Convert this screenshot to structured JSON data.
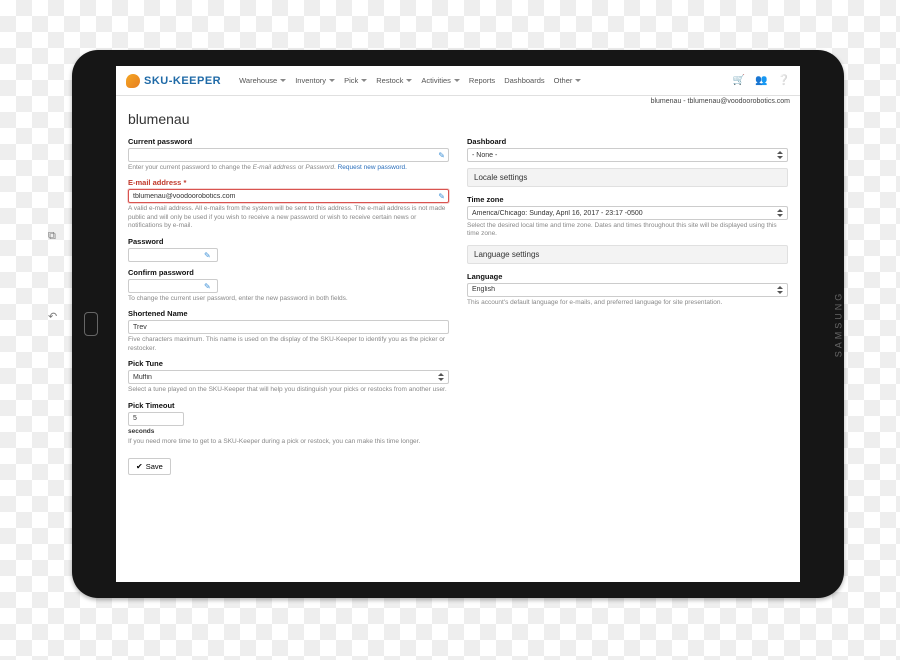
{
  "brand_side": "SAMSUNG",
  "logo_text": "SKU-KEEPER",
  "nav": [
    "Warehouse",
    "Inventory",
    "Pick",
    "Restock",
    "Activities",
    "Reports",
    "Dashboards",
    "Other"
  ],
  "nav_has_caret": [
    true,
    true,
    true,
    true,
    true,
    false,
    false,
    true
  ],
  "user_line": "blumenau - tblumenau@voodoorobotics.com",
  "page_title": "blumenau",
  "left": {
    "current_password": {
      "label": "Current password",
      "value": "",
      "help_pre": "Enter your current password to change the ",
      "help_em": "E-mail address",
      "help_mid": " or ",
      "help_em2": "Password",
      "help_suf": ". ",
      "link": "Request new password."
    },
    "email": {
      "label": "E-mail address",
      "value": "tblumenau@voodoorobotics.com",
      "help": "A valid e-mail address. All e-mails from the system will be sent to this address. The e-mail address is not made public and will only be used if you wish to receive a new password or wish to receive certain news or notifications by e-mail."
    },
    "password": {
      "label": "Password"
    },
    "confirm": {
      "label": "Confirm password",
      "help": "To change the current user password, enter the new password in both fields."
    },
    "shortname": {
      "label": "Shortened Name",
      "value": "Trev",
      "help": "Five characters maximum. This name is used on the display of the SKU-Keeper to identify you as the picker or restocker."
    },
    "picktune": {
      "label": "Pick Tune",
      "value": "Muffin",
      "help": "Select a tune played on the SKU-Keeper that will help you distinguish your picks or restocks from another user."
    },
    "timeout": {
      "label": "Pick Timeout",
      "value": "5",
      "unit": "seconds",
      "help": "If you need more time to get to a SKU-Keeper during a pick or restock, you can make this time longer."
    },
    "save": "Save"
  },
  "right": {
    "dash_label": "Dashboard",
    "dash_value": "- None -",
    "locale_head": "Locale settings",
    "tz_label": "Time zone",
    "tz_value": "America/Chicago: Sunday, April 16, 2017 - 23:17 -0500",
    "tz_help": "Select the desired local time and time zone. Dates and times throughout this site will be displayed using this time zone.",
    "lang_head": "Language settings",
    "lang_label": "Language",
    "lang_value": "English",
    "lang_help": "This account's default language for e-mails, and preferred language for site presentation."
  }
}
